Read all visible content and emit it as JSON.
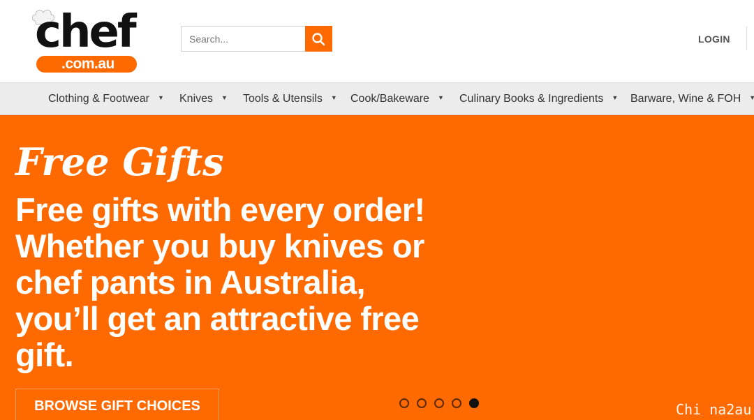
{
  "header": {
    "logo": {
      "main": "chef",
      "domain": ".com.au",
      "accent": "#ff6a00"
    },
    "search": {
      "placeholder": "Search...",
      "button_icon": "search-icon"
    },
    "login_label": "LOGIN"
  },
  "nav": {
    "items": [
      {
        "label": "Clothing & Footwear"
      },
      {
        "label": "Knives"
      },
      {
        "label": "Tools & Utensils"
      },
      {
        "label": "Cook/Bakeware"
      },
      {
        "label": "Culinary Books & Ingredients"
      },
      {
        "label": "Barware, Wine & FOH"
      }
    ],
    "caret": "▼"
  },
  "hero": {
    "script_title": "Free Gifts",
    "text": "Free gifts with every order! Whether you buy knives or chef pants in Australia, you’ll get an attractive free gift.",
    "button_label": "BROWSE GIFT CHOICES",
    "background": "#ff6a00",
    "slides": {
      "count": 5,
      "active_index": 4
    },
    "watermark": "Chi na2au"
  }
}
